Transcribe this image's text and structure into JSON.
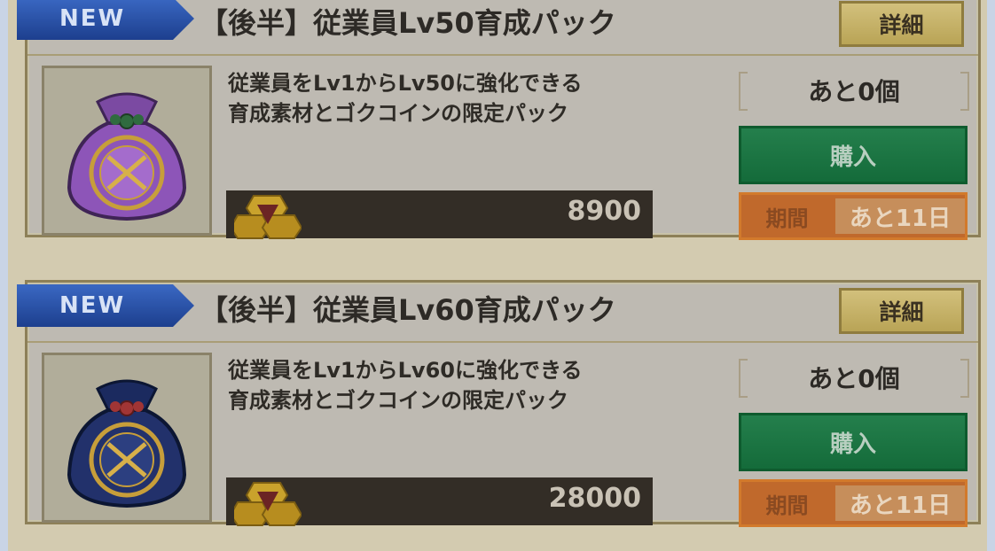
{
  "cards": [
    {
      "badge": "NEW",
      "title": "【後半】従業員Lv50育成パック",
      "detail_label": "詳細",
      "description_line1": "従業員をLv1からLv50に強化できる",
      "description_line2": "育成素材とゴクコインの限定パック",
      "price": "8900",
      "remaining": "あと0個",
      "buy_label": "購入",
      "period_label": "期間",
      "period_value": "あと11日",
      "bag_color": "#8d55b8"
    },
    {
      "badge": "NEW",
      "title": "【後半】従業員Lv60育成パック",
      "detail_label": "詳細",
      "description_line1": "従業員をLv1からLv60に強化できる",
      "description_line2": "育成素材とゴクコインの限定パック",
      "price": "28000",
      "remaining": "あと0個",
      "buy_label": "購入",
      "period_label": "期間",
      "period_value": "あと11日",
      "bag_color": "#22316b"
    }
  ],
  "icons": {
    "coin": "coin-icon",
    "bag": "pouch-icon"
  }
}
